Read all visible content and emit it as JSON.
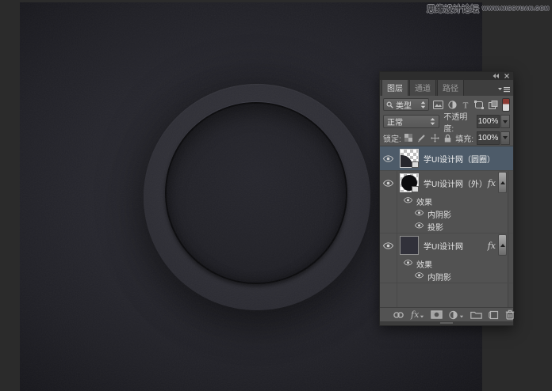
{
  "watermark": {
    "title": "思缘设计论坛",
    "subtitle": "WWW.MISSYUAN.COM"
  },
  "panel": {
    "window_controls": {
      "collapse_icon": "double-left-arrows-icon",
      "close_icon": "close-icon"
    },
    "tabs": [
      {
        "label": "图层",
        "active": true
      },
      {
        "label": "通道",
        "active": false
      },
      {
        "label": "路径",
        "active": false
      }
    ],
    "filter": {
      "kind": "类型",
      "icons": [
        "pixel-layer-filter-icon",
        "adjustment-layer-filter-icon",
        "type-layer-filter-icon",
        "shape-layer-filter-icon",
        "smart-object-filter-icon"
      ],
      "toggle_icon": "layer-filtering-switch"
    },
    "blend": {
      "mode": "正常",
      "opacity_label": "不透明度:",
      "opacity": "100%"
    },
    "lock": {
      "label": "锁定:",
      "icons": [
        "lock-transparency-icon",
        "lock-pixels-icon",
        "lock-position-icon",
        "lock-all-icon"
      ],
      "fill_label": "填充:",
      "fill": "100%"
    },
    "fx_badge": "fx",
    "layers": [
      {
        "name": "学UI设计网（圆圈）",
        "selected": true,
        "thumb": "checker-quarter",
        "fx": false,
        "effects_label": "",
        "effects": []
      },
      {
        "name": "学UI设计网（外）",
        "selected": false,
        "thumb": "checker-circle",
        "fx": true,
        "effects_label": "效果",
        "effects": [
          "内阴影",
          "投影"
        ]
      },
      {
        "name": "学UI设计网",
        "selected": false,
        "thumb": "solid",
        "fx": true,
        "effects_label": "效果",
        "effects": [
          "内阴影"
        ]
      }
    ],
    "footer_icons": [
      "link-layers-icon",
      "add-layer-style-icon",
      "add-layer-mask-icon",
      "new-adjustment-layer-icon",
      "new-group-icon",
      "new-layer-icon",
      "delete-layer-icon"
    ],
    "colors": {
      "panel_bg": "#535353",
      "selected_row": "#4d5b69",
      "switch_red": "#8c3a33",
      "canvas_base": "#26262d"
    }
  }
}
